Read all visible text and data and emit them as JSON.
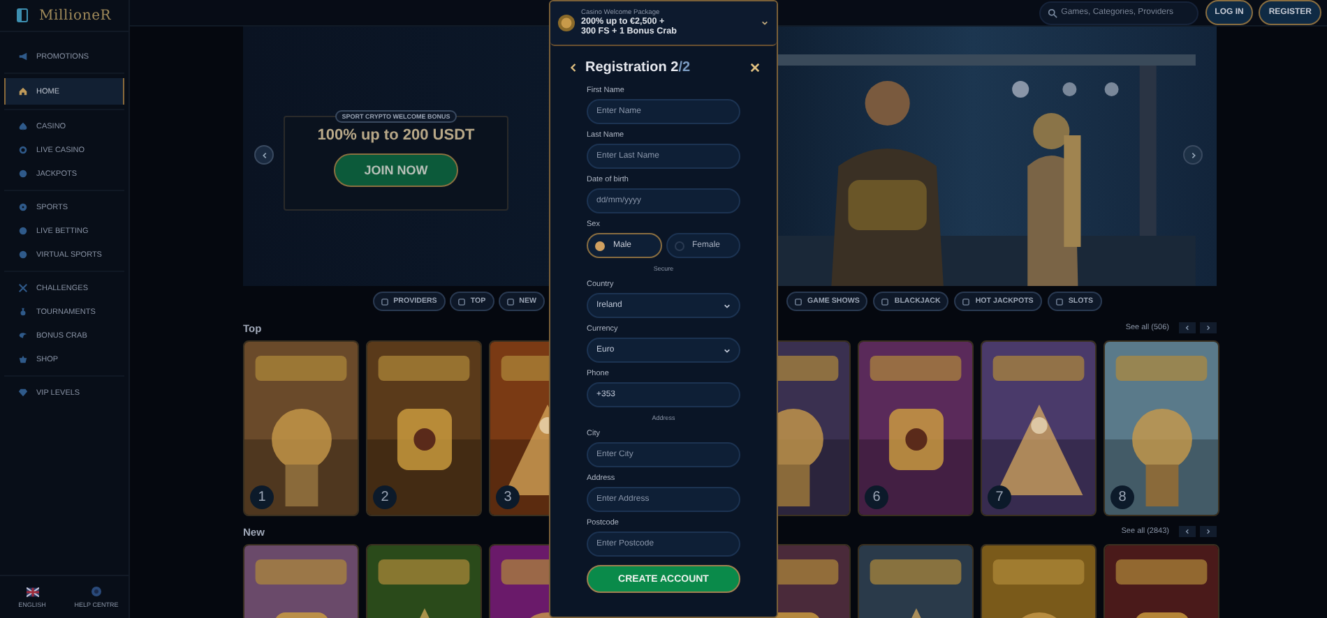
{
  "sidebar": {
    "logo": "MillioneR",
    "sections": [
      {
        "items": [
          {
            "label": "PROMOTIONS",
            "selected": false
          }
        ]
      },
      {
        "items": [
          {
            "label": "HOME",
            "selected": true
          }
        ]
      },
      {
        "items": [
          {
            "label": "CASINO",
            "selected": false
          },
          {
            "label": "LIVE CASINO",
            "selected": false
          },
          {
            "label": "JACKPOTS",
            "selected": false
          }
        ]
      },
      {
        "items": [
          {
            "label": "SPORTS",
            "selected": false
          },
          {
            "label": "LIVE BETTING",
            "selected": false
          },
          {
            "label": "VIRTUAL SPORTS",
            "selected": false
          }
        ]
      },
      {
        "items": [
          {
            "label": "CHALLENGES",
            "selected": false
          },
          {
            "label": "TOURNAMENTS",
            "selected": false
          },
          {
            "label": "BONUS CRAB",
            "selected": false
          },
          {
            "label": "SHOP",
            "selected": false
          }
        ]
      },
      {
        "items": [
          {
            "label": "VIP LEVELS",
            "selected": false
          }
        ]
      }
    ],
    "footer": [
      {
        "label": "ENGLISH"
      },
      {
        "label": "HELP CENTRE"
      }
    ]
  },
  "header": {
    "search": {
      "placeholder": "Games, Categories, Providers"
    },
    "buttons": [
      "LOG IN",
      "REGISTER"
    ]
  },
  "banner": {
    "kind": "picture",
    "promo": {
      "tag": "SPORT CRYPTO WELCOME BONUS",
      "headline": "100% up to 200 USDT",
      "button": "JOIN NOW"
    }
  },
  "categories_left": [
    "PROVIDERS",
    "TOP",
    "NEW"
  ],
  "categories_right": [
    "GAME SHOWS",
    "BLACKJACK",
    "HOT JACKPOTS",
    "SLOTS"
  ],
  "sections": [
    {
      "title": "Top",
      "see_all": "See all (506)",
      "tiles_left": [
        {
          "kind": "picture",
          "rank": "1"
        },
        {
          "kind": "picture",
          "rank": "2"
        },
        {
          "kind": "picture",
          "rank": "3"
        }
      ],
      "tiles_right": [
        {
          "kind": "picture"
        },
        {
          "kind": "picture",
          "rank": "6"
        },
        {
          "kind": "picture",
          "rank": "7"
        },
        {
          "kind": "picture",
          "rank": "8"
        }
      ]
    },
    {
      "title": "New",
      "see_all": "See all (2843)",
      "tiles_left": [
        {
          "kind": "picture"
        },
        {
          "kind": "picture"
        },
        {
          "kind": "picture"
        }
      ],
      "tiles_right": [
        {
          "kind": "picture"
        },
        {
          "kind": "picture"
        },
        {
          "kind": "picture"
        },
        {
          "kind": "picture"
        }
      ]
    }
  ],
  "modal": {
    "promo": {
      "caption": "Casino Welcome Package",
      "lines": [
        "200% up to €2,500 +",
        "300 FS + 1 Bonus Crab"
      ]
    },
    "title": "Registration 2",
    "step_total": "/2",
    "fields": [
      {
        "kind": "text",
        "label": "First Name",
        "placeholder": "Enter Name"
      },
      {
        "kind": "text",
        "label": "Last Name",
        "placeholder": "Enter Last Name"
      },
      {
        "kind": "text",
        "label": "Date of birth",
        "placeholder": "dd/mm/yyyy"
      },
      {
        "kind": "radio",
        "label": "Sex",
        "options": [
          {
            "label": "Male",
            "selected": true
          },
          {
            "label": "Female",
            "selected": false
          }
        ]
      },
      {
        "kind": "divider",
        "label": "Secure"
      },
      {
        "kind": "select",
        "label": "Country",
        "value": "Ireland"
      },
      {
        "kind": "select",
        "label": "Currency",
        "value": "Euro"
      },
      {
        "kind": "text",
        "label": "Phone",
        "value": "+353"
      },
      {
        "kind": "divider",
        "label": "Address"
      },
      {
        "kind": "text",
        "label": "City",
        "placeholder": "Enter City"
      },
      {
        "kind": "text",
        "label": "Address",
        "placeholder": "Enter Address"
      },
      {
        "kind": "text",
        "label": "Postcode",
        "placeholder": "Enter Postcode"
      }
    ],
    "submit": "CREATE ACCOUNT"
  }
}
